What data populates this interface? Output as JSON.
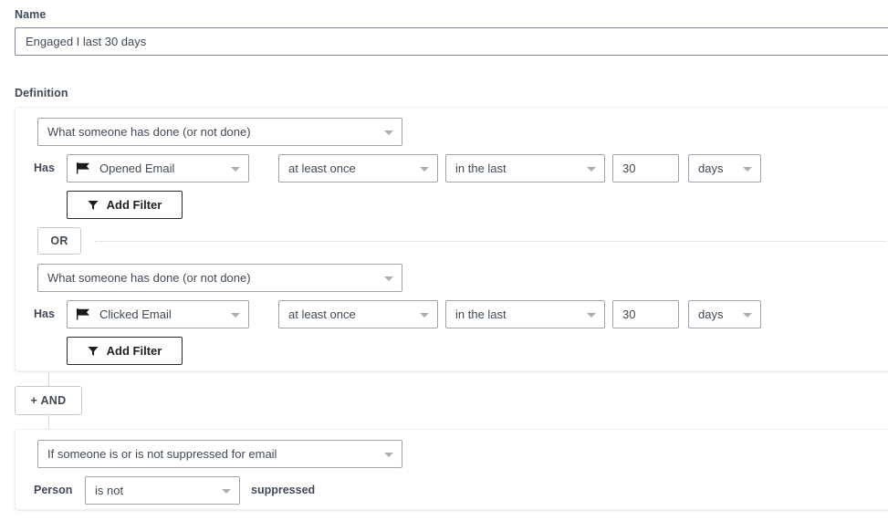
{
  "name_section": {
    "label": "Name",
    "value": "Engaged I last 30 days",
    "placeholder": "Name"
  },
  "definition_section": {
    "label": "Definition",
    "blocks": [
      {
        "type_select": "What someone has done (or not done)",
        "conditions": [
          {
            "prefix_label": "Has",
            "metric": "Opened Email",
            "metric_icon": "flag-icon",
            "frequency": "at least once",
            "timeframe": "in the last",
            "amount": "30",
            "unit": "days",
            "add_filter_label": "Add Filter",
            "add_filter_icon": "funnel-icon"
          }
        ]
      },
      {
        "operator": "OR",
        "type_select": "What someone has done (or not done)",
        "conditions": [
          {
            "prefix_label": "Has",
            "metric": "Clicked Email",
            "metric_icon": "flag-icon",
            "frequency": "at least once",
            "timeframe": "in the last",
            "amount": "30",
            "unit": "days",
            "add_filter_label": "Add Filter",
            "add_filter_icon": "funnel-icon"
          }
        ]
      }
    ],
    "and_button": {
      "label": "+ AND"
    },
    "suppression_block": {
      "type_select": "If someone is or is not suppressed for email",
      "prefix_label": "Person",
      "operator": "is not",
      "suffix_label": "suppressed"
    }
  },
  "colors": {
    "text": "#3f4a56",
    "border": "#9aa4ae",
    "card_border": "#eceef0",
    "caret": "#a7b0b9",
    "dark_border": "#2b2b2b"
  }
}
